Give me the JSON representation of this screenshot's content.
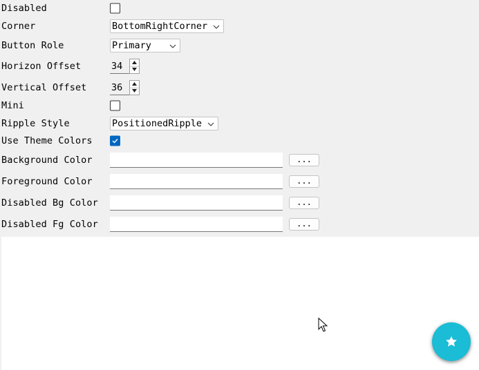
{
  "form": {
    "disabled": {
      "label": "Disabled",
      "checked": false
    },
    "corner": {
      "label": "Corner",
      "value": "BottomRightCorner"
    },
    "button_role": {
      "label": "Button Role",
      "value": "Primary"
    },
    "horizon_offset": {
      "label": "Horizon Offset",
      "value": "34"
    },
    "vertical_offset": {
      "label": "Vertical Offset",
      "value": "36"
    },
    "mini": {
      "label": "Mini",
      "checked": false
    },
    "ripple_style": {
      "label": "Ripple Style",
      "value": "PositionedRipple"
    },
    "use_theme_colors": {
      "label": "Use Theme Colors",
      "checked": true
    },
    "background_color": {
      "label": "Background Color",
      "value": "",
      "button": "..."
    },
    "foreground_color": {
      "label": "Foreground Color",
      "value": "",
      "button": "..."
    },
    "disabled_bg_color": {
      "label": "Disabled Bg Color",
      "value": "",
      "button": "..."
    },
    "disabled_fg_color": {
      "label": "Disabled Fg Color",
      "value": "",
      "button": "..."
    }
  },
  "preview": {
    "fab_icon": "star-icon",
    "fab_color": "#1bbcd5"
  },
  "colors": {
    "accent": "#0067c0",
    "panel_bg": "#f0f0f0"
  }
}
